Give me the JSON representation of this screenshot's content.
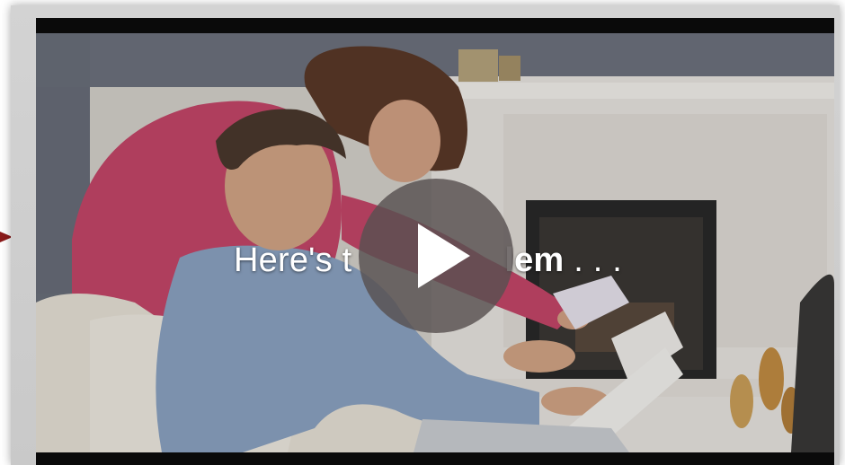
{
  "video": {
    "caption_text": "Here's t",
    "caption_emph": "lem",
    "caption_tail": " . . .",
    "state": "paused"
  },
  "icons": {
    "play": "play-icon",
    "pointer": "arrow-right-icon"
  },
  "colors": {
    "play_button_bg": "#585050",
    "play_icon": "#ffffff",
    "pointer_arrow": "#8b1a1a"
  }
}
